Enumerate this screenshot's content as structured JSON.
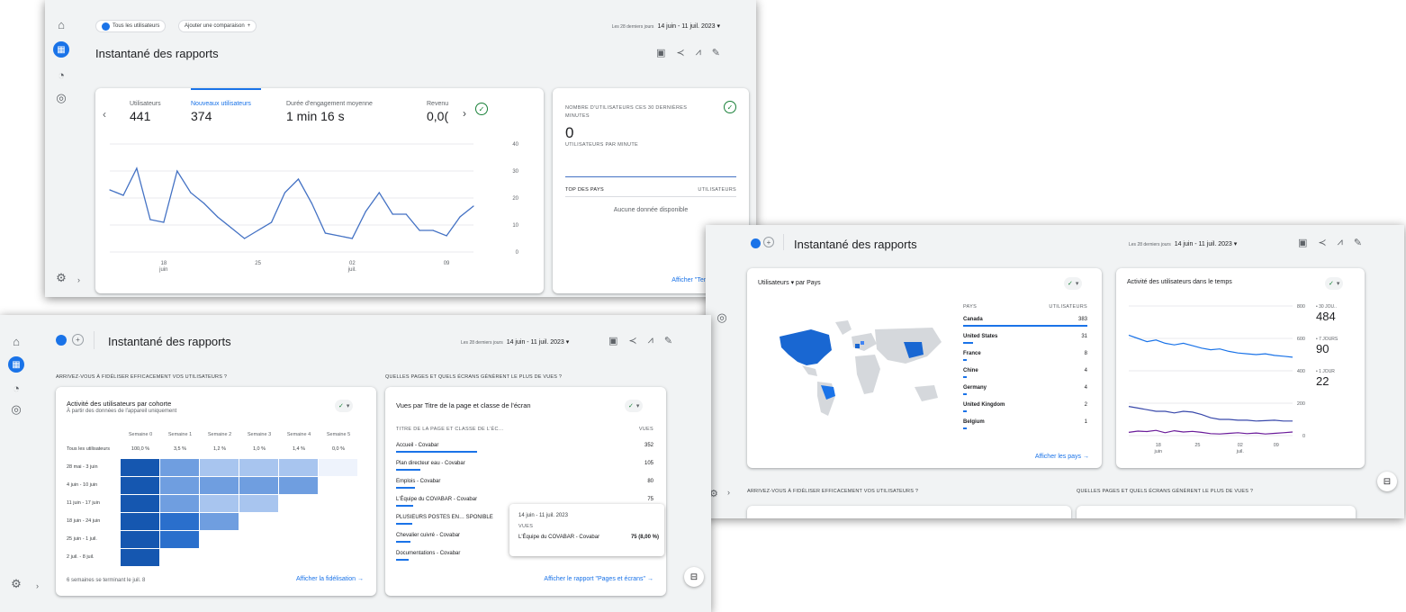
{
  "colors": {
    "accent": "#1a73e8",
    "ok": "#188038",
    "line": "#4472c4"
  },
  "shot1": {
    "compare": {
      "all_users": "Tous les utilisateurs",
      "add": "Ajouter une comparaison"
    },
    "date": {
      "label": "Les 28 derniers jours",
      "range": "14 juin - 11 juil. 2023"
    },
    "title": "Instantané des rapports",
    "metrics": [
      {
        "label": "Utilisateurs",
        "value": "441"
      },
      {
        "label": "Nouveaux utilisateurs",
        "value": "374"
      },
      {
        "label": "Durée d'engagement moyenne",
        "value": "1 min 16 s"
      },
      {
        "label": "Revenu",
        "value": "0,0("
      }
    ],
    "chart_data": {
      "type": "line",
      "x": [
        "14 juin",
        "15",
        "16",
        "17",
        "18",
        "19",
        "20",
        "21",
        "22",
        "23",
        "24",
        "25",
        "26",
        "27",
        "28",
        "29",
        "30",
        "1",
        "2",
        "3",
        "4",
        "5",
        "6",
        "7",
        "8",
        "9",
        "10",
        "11 juil."
      ],
      "series": [
        {
          "values": [
            23,
            21,
            31,
            12,
            11,
            30,
            22,
            18,
            13,
            9,
            5,
            8,
            11,
            22,
            27,
            18,
            7,
            6,
            5,
            15,
            22,
            14,
            14,
            8,
            8,
            6,
            13,
            17
          ]
        }
      ],
      "ylim": [
        0,
        40
      ],
      "yticks": [
        "40",
        "30",
        "20",
        "10",
        "0"
      ],
      "xticks": [
        {
          "d": "18",
          "m": "juin"
        },
        {
          "d": "25",
          "m": ""
        },
        {
          "d": "02",
          "m": "juil."
        },
        {
          "d": "09",
          "m": ""
        }
      ]
    },
    "realtime": {
      "header": "Nombre d'utilisateurs ces 30 dernières minutes",
      "value": "0",
      "per_minute": "Utilisateurs par minute",
      "top_countries": "Top des pays",
      "users_col": "Utilisateurs",
      "no_data": "Aucune donnée disponible",
      "link": "Afficher \"Temps réel\""
    }
  },
  "shot2": {
    "title": "Instantané des rapports",
    "date": {
      "label": "Les 28 derniers jours",
      "range": "14 juin - 11 juil. 2023"
    },
    "map_card": {
      "title_metric": "Utilisateurs",
      "title_rest": "par Pays",
      "col_country": "Pays",
      "col_users": "Utilisateurs",
      "rows": [
        {
          "country": "Canada",
          "users": "383",
          "share": 1.0
        },
        {
          "country": "United States",
          "users": "31",
          "share": 0.08
        },
        {
          "country": "France",
          "users": "8",
          "share": 0.02
        },
        {
          "country": "Chine",
          "users": "4",
          "share": 0.01
        },
        {
          "country": "Germany",
          "users": "4",
          "share": 0.01
        },
        {
          "country": "United Kingdom",
          "users": "2",
          "share": 0.005
        },
        {
          "country": "Belgium",
          "users": "1",
          "share": 0.003
        }
      ],
      "link": "Afficher les pays"
    },
    "activity_card": {
      "title": "Activité des utilisateurs dans le temps",
      "legend": [
        {
          "label": "30 jou..",
          "value": "484"
        },
        {
          "label": "7 jours",
          "value": "90"
        },
        {
          "label": "1 jour",
          "value": "22"
        }
      ],
      "chart_data": {
        "type": "line",
        "ylim": [
          0,
          800
        ],
        "yticks": [
          "800",
          "600",
          "400",
          "200",
          "0"
        ],
        "series": [
          {
            "name": "30 jours",
            "values": [
              620,
              600,
              580,
              590,
              570,
              560,
              570,
              555,
              540,
              530,
              535,
              520,
              510,
              505,
              500,
              505,
              495,
              490,
              484
            ]
          },
          {
            "name": "7 jours",
            "values": [
              180,
              170,
              160,
              150,
              150,
              140,
              150,
              145,
              130,
              110,
              100,
              100,
              95,
              95,
              90,
              92,
              95,
              90,
              90
            ]
          },
          {
            "name": "1 jour",
            "values": [
              20,
              28,
              25,
              32,
              18,
              30,
              22,
              26,
              20,
              12,
              10,
              14,
              18,
              12,
              16,
              10,
              14,
              18,
              22
            ]
          }
        ],
        "xticks": [
          {
            "d": "18",
            "m": "juin"
          },
          {
            "d": "25",
            "m": ""
          },
          {
            "d": "02",
            "m": "juil."
          },
          {
            "d": "09",
            "m": ""
          }
        ]
      }
    },
    "section_left": "Arrivez-vous à fidéliser efficacement vos utilisateurs ?",
    "section_right": "Quelles pages et quels écrans génèrent le plus de vues ?"
  },
  "shot3": {
    "title": "Instantané des rapports",
    "date": {
      "label": "Les 28 derniers jours",
      "range": "14 juin - 11 juil. 2023"
    },
    "section_left": "Arrivez-vous à fidéliser efficacement vos utilisateurs ?",
    "section_right": "Quelles pages et quels écrans génèrent le plus de vues ?",
    "cohort": {
      "title": "Activité des utilisateurs par cohorte",
      "subtitle": "À partir des données de l'appareil uniquement",
      "weeks": [
        "Semaine 0",
        "Semaine 1",
        "Semaine 2",
        "Semaine 3",
        "Semaine 4",
        "Semaine 5"
      ],
      "all_label": "Tous les utilisateurs",
      "all_values": [
        "100,0 %",
        "3,5 %",
        "1,2 %",
        "1,0 %",
        "1,4 %",
        "0,0 %"
      ],
      "rows": [
        {
          "label": "28 mai - 3 juin",
          "levels": [
            1,
            0.45,
            0.35,
            0.3,
            0.3,
            0
          ]
        },
        {
          "label": "4 juin - 10 juin",
          "levels": [
            1,
            0.5,
            0.5,
            0.45,
            0.5
          ]
        },
        {
          "label": "11 juin - 17 juin",
          "levels": [
            1,
            0.5,
            0.4,
            0.35
          ]
        },
        {
          "label": "18 juin - 24 juin",
          "levels": [
            1,
            0.8,
            0.45
          ]
        },
        {
          "label": "25 juin - 1 juil.",
          "levels": [
            1,
            0.9
          ]
        },
        {
          "label": "2 juil. - 8 juil.",
          "levels": [
            1
          ]
        }
      ],
      "footer": "6 semaines se terminant le juil. 8",
      "link": "Afficher la fidélisation"
    },
    "pages": {
      "title": "Vues par Titre de la page et classe de l'écran",
      "col_title": "Titre de la page et classe de l'éc…",
      "col_views": "Vues",
      "rows": [
        {
          "title": "Accueil - Covabar",
          "views": "352",
          "share": 1.0
        },
        {
          "title": "Plan directeur eau - Covabar",
          "views": "105",
          "share": 0.3
        },
        {
          "title": "Emplois - Covabar",
          "views": "80",
          "share": 0.23
        },
        {
          "title": "L'Équipe du COVABAR - Covabar",
          "views": "75",
          "share": 0.21
        },
        {
          "title": "PLUSIEURS POSTES EN… SPONIBLE",
          "views": "",
          "share": 0.2
        },
        {
          "title": "Chevalier cuivré - Covabar",
          "views": "",
          "share": 0.18
        },
        {
          "title": "Documentations - Covabar",
          "views": "",
          "share": 0.16
        }
      ],
      "tooltip": {
        "date": "14 juin - 11 juil. 2023",
        "label": "Vues",
        "row": "L'Équipe du COVABAR - Covabar",
        "value": "75 (8,00 %)"
      },
      "link": "Afficher le rapport \"Pages et écrans\""
    }
  }
}
